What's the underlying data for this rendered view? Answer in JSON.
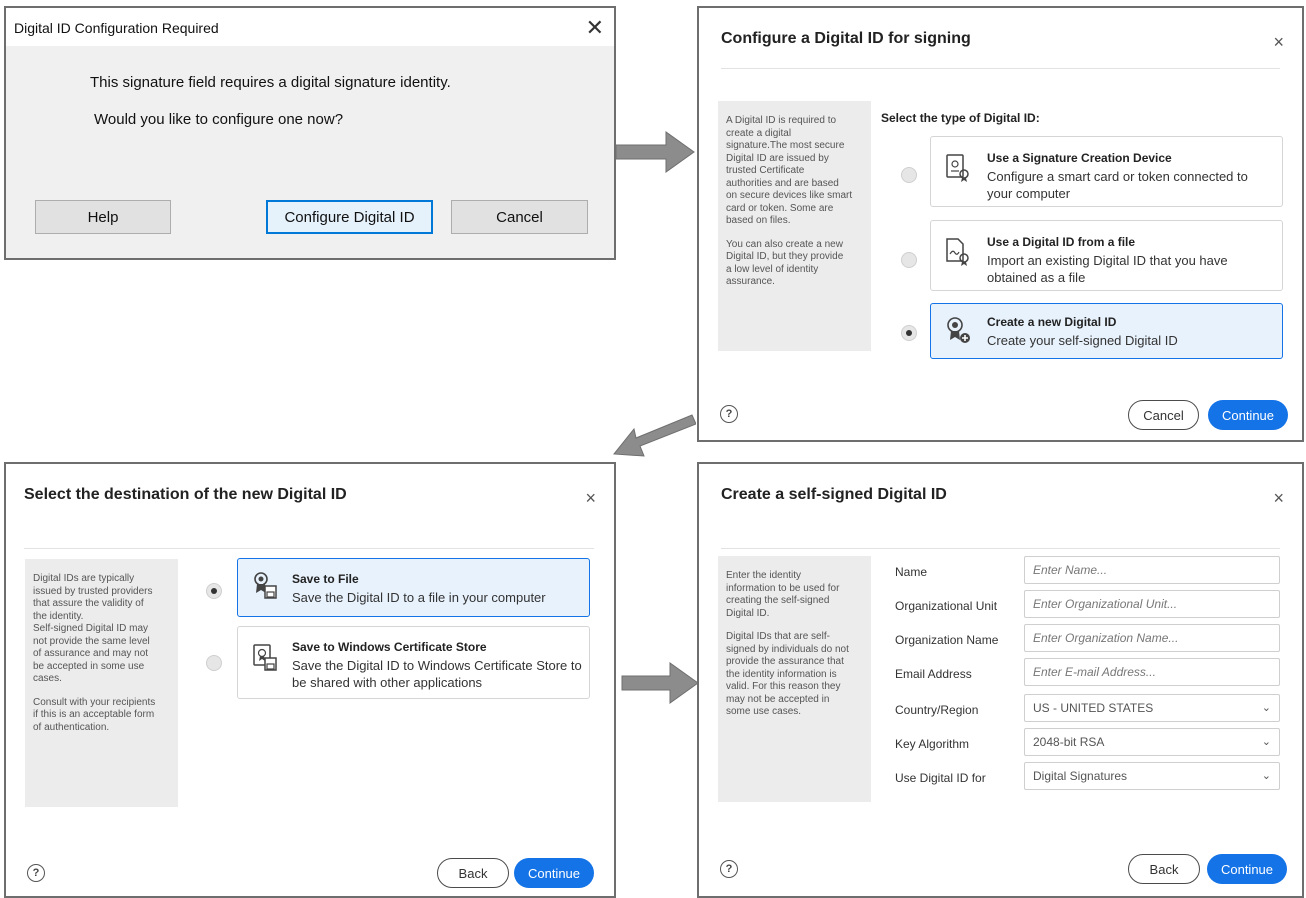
{
  "dialog1": {
    "title": "Digital ID Configuration Required",
    "close_glyph": "✕",
    "message1": "This signature field requires a digital signature identity.",
    "message2": "Would you like to configure one now?",
    "help_label": "Help",
    "configure_label": "Configure Digital ID",
    "cancel_label": "Cancel"
  },
  "dialog2": {
    "title": "Configure a Digital ID for signing",
    "close_glyph": "×",
    "info_p1": "A Digital ID is required to\ncreate a digital\nsignature.The most secure\nDigital ID are issued by\ntrusted Certificate\nauthorities and are based\non secure devices like smart\ncard or token. Some are\nbased on files.",
    "info_p2": "You can also create a new\nDigital ID, but they provide\na low level of identity\nassurance.",
    "heading": "Select the type of Digital ID:",
    "options": [
      {
        "title": "Use a Signature Creation Device",
        "desc": "Configure a smart card or token connected to your computer",
        "icon": "signature-device-icon",
        "selected": false
      },
      {
        "title": "Use a Digital ID from a file",
        "desc": "Import an existing Digital ID that you have obtained as a file",
        "icon": "digital-id-file-icon",
        "selected": false
      },
      {
        "title": "Create a new Digital ID",
        "desc": "Create your self-signed Digital ID",
        "icon": "new-digital-id-icon",
        "selected": true
      }
    ],
    "help_glyph": "?",
    "cancel_label": "Cancel",
    "continue_label": "Continue"
  },
  "dialog3": {
    "title": "Select the destination of the new Digital ID",
    "close_glyph": "×",
    "info_p1": "Digital IDs are typically\nissued by trusted providers\nthat assure the validity of\nthe identity.\nSelf-signed Digital ID may\nnot provide the same level\nof assurance and may not\nbe accepted in some use\ncases.",
    "info_p2": "Consult with your recipients\nif this is an acceptable form\nof authentication.",
    "options": [
      {
        "title": "Save to File",
        "desc": "Save the Digital ID to a file in your computer",
        "icon": "save-to-file-icon",
        "selected": true
      },
      {
        "title": "Save to Windows Certificate Store",
        "desc": "Save the Digital ID to Windows Certificate Store to be shared with other applications",
        "icon": "certificate-store-icon",
        "selected": false
      }
    ],
    "help_glyph": "?",
    "back_label": "Back",
    "continue_label": "Continue"
  },
  "dialog4": {
    "title": "Create a self-signed Digital ID",
    "close_glyph": "×",
    "info_p1": "Enter the identity\ninformation to be used for\ncreating the self-signed\nDigital ID.",
    "info_p2": "Digital IDs that are self-\nsigned by individuals do not\nprovide the assurance that\nthe identity information is\nvalid. For this reason they\nmay not be accepted in\nsome use cases.",
    "fields": [
      {
        "label": "Name",
        "placeholder": "Enter Name...",
        "value": ""
      },
      {
        "label": "Organizational Unit",
        "placeholder": "Enter Organizational Unit...",
        "value": ""
      },
      {
        "label": "Organization Name",
        "placeholder": "Enter Organization Name...",
        "value": ""
      },
      {
        "label": "Email Address",
        "placeholder": "Enter E-mail Address...",
        "value": ""
      }
    ],
    "selects": [
      {
        "label": "Country/Region",
        "value": "US - UNITED STATES"
      },
      {
        "label": "Key Algorithm",
        "value": "2048-bit RSA"
      },
      {
        "label": "Use Digital ID for",
        "value": "Digital Signatures"
      }
    ],
    "chevron_glyph": "⌄",
    "help_glyph": "?",
    "back_label": "Back",
    "continue_label": "Continue"
  },
  "colors": {
    "accent": "#1473e6",
    "arrow": "#8c8c8c",
    "windows_focus": "#0078d7"
  }
}
